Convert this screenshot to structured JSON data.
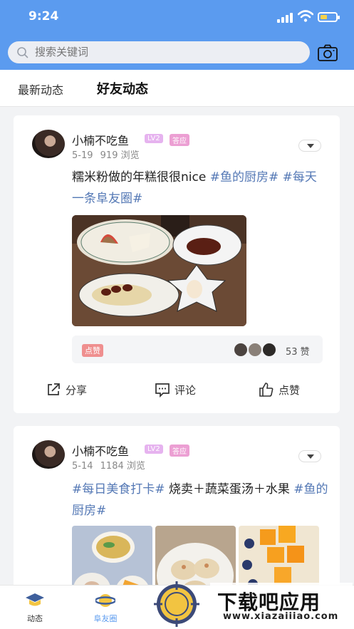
{
  "status_bar": {
    "time": "9:24"
  },
  "search": {
    "placeholder": "搜索关键词"
  },
  "tabs": [
    {
      "label": "最新动态",
      "active": false
    },
    {
      "label": "好友动态",
      "active": true
    }
  ],
  "posts": [
    {
      "user": "小楠不吃鱼",
      "level": "LV2",
      "badge": "答应",
      "date": "5-19",
      "views": "919 浏览",
      "text": "糯米粉做的年糕很很nice ",
      "tags": [
        "#鱼的厨房#",
        " #每天一条阜友圈#"
      ],
      "like_badge": "点赞",
      "like_count": "53 赞",
      "actions": {
        "share": "分享",
        "comment": "评论",
        "like": "点赞"
      }
    },
    {
      "user": "小楠不吃鱼",
      "level": "LV2",
      "badge": "答应",
      "date": "5-14",
      "views": "1184 浏览",
      "tag_first": "#每日美食打卡#",
      "text": " 烧卖＋蔬菜蛋汤＋水果",
      "tag_last": " #鱼的厨房#"
    }
  ],
  "bottom_nav": [
    {
      "label": "动态",
      "icon": "graduation-cap-icon",
      "active": false
    },
    {
      "label": "阜友圈",
      "icon": "planet-icon",
      "active": true
    }
  ],
  "watermark": {
    "title": "下载吧应用",
    "url": "www.xiazaiiiao.com"
  },
  "colors": {
    "primary": "#5b9bef",
    "tag": "#5478b5",
    "like_badge": "#ef8f8f"
  }
}
